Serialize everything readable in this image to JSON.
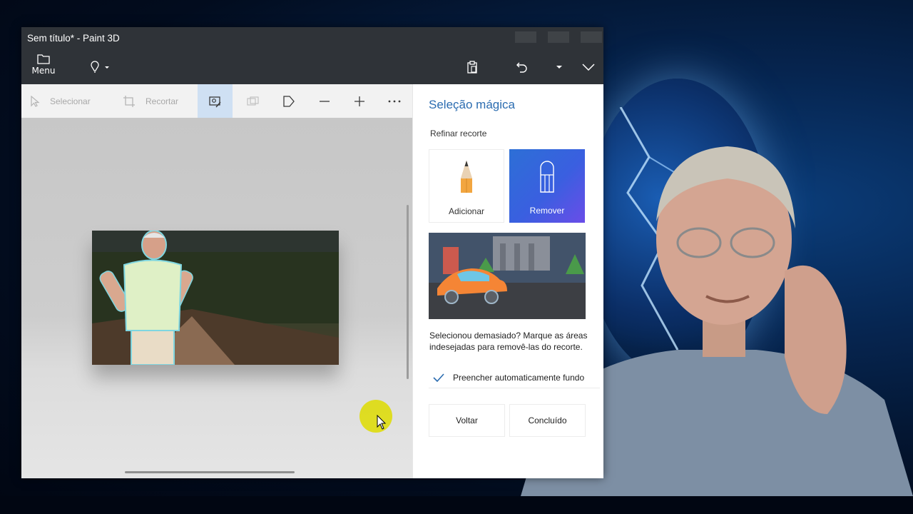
{
  "window": {
    "title": "Sem título* - Paint 3D",
    "menu_label": "Menu"
  },
  "titlebar_icons": [
    "magic-hint-icon",
    "paste-icon",
    "undo-icon",
    "history-dropdown-icon",
    "expand-chevron-icon"
  ],
  "toolbar": {
    "select_label": "Selecionar",
    "crop_label": "Recortar"
  },
  "panel": {
    "title": "Seleção mágica",
    "subtitle": "Refinar recorte",
    "add_label": "Adicionar",
    "remove_label": "Remover",
    "help_text": "Selecionou demasiado? Marque as áreas indesejadas para removê-las do recorte.",
    "autofill_label": "Preencher automaticamente fundo",
    "autofill_checked": true,
    "back_label": "Voltar",
    "done_label": "Concluído"
  },
  "colors": {
    "titlebar": "#2f3338",
    "accent": "#2b6cb0",
    "remove_gradient_start": "#2d6fd6",
    "remove_gradient_end": "#6a4de8",
    "active_tool": "#cfe0f3"
  }
}
